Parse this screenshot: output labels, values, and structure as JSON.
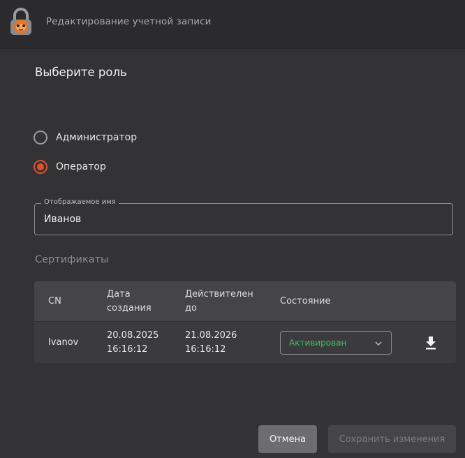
{
  "window": {
    "title": "Редактирование учетной записи",
    "icon": "lock-app-icon"
  },
  "role": {
    "title": "Выберите роль",
    "options": [
      {
        "label": "Администратор",
        "selected": false
      },
      {
        "label": "Оператор",
        "selected": true
      }
    ]
  },
  "display_name": {
    "label": "Отображаемое имя",
    "value": "Иванов"
  },
  "certificates": {
    "title": "Сертификаты",
    "headers": {
      "cn": "CN",
      "created_1": "Дата",
      "created_2": "создания",
      "valid_1": "Действителен",
      "valid_2": "до",
      "state": "Состояние"
    },
    "rows": [
      {
        "cn": "Ivanov",
        "created_date": "20.08.2025",
        "created_time": "16:16:12",
        "valid_date": "21.08.2026",
        "valid_time": "16:16:12",
        "state": "Активирован"
      }
    ]
  },
  "buttons": {
    "cancel": "Отмена",
    "save": "Сохранить изменения"
  },
  "colors": {
    "accent": "#e0512e",
    "status_active": "#3fbf6a",
    "background": "#333335"
  }
}
